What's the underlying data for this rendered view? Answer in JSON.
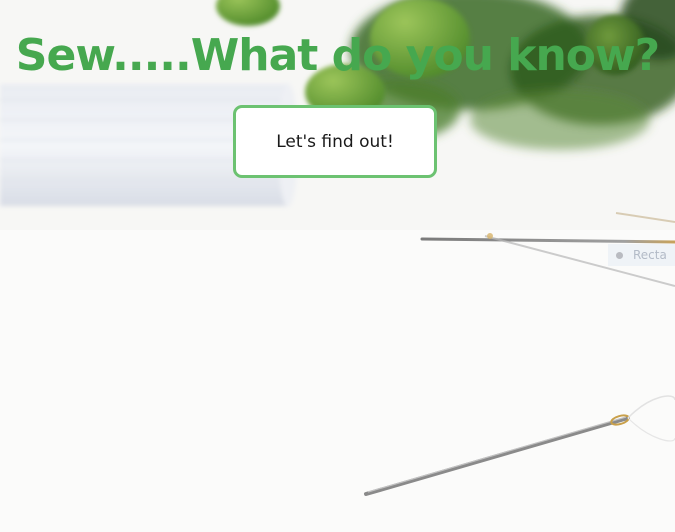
{
  "hero": {
    "title": "Sew.....What do you know?",
    "button_label": "Let's find out!"
  },
  "overlay": {
    "faint_label": "Recta"
  },
  "colors": {
    "title": "#46a84f",
    "button_border": "#6cc271",
    "button_background": "#ffffff",
    "page_background": "#f6f6f4"
  },
  "background_photo": {
    "subject": "sewing-needles-thread-spool-leaves"
  }
}
